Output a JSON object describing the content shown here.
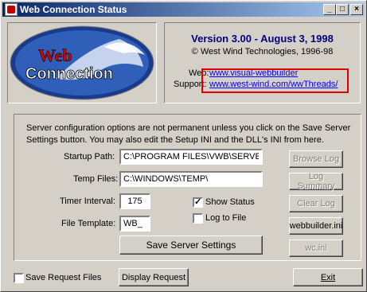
{
  "window": {
    "title": "Web Connection Status"
  },
  "titlebar_buttons": {
    "minimize": "_",
    "maximize": "□",
    "close": "×"
  },
  "logo": {
    "line1": "Web",
    "line2": "Connection"
  },
  "info": {
    "version": "Version 3.00 - August 3, 1998",
    "copyright": "© West Wind Technologies, 1996-98",
    "web_label": "Web:",
    "web_link": "www.visual-webbuilder",
    "support_label": "Support:",
    "support_link": "www.west-wind.com/wwThreads/"
  },
  "settings": {
    "description": "Server configuration options are not permanent unless you click on the Save Server Settings button. You may also edit the Setup INI and the DLL's INI from here.",
    "startup_path_label": "Startup Path:",
    "startup_path_value": "C:\\PROGRAM FILES\\VWB\\SERVER\\",
    "temp_files_label": "Temp Files:",
    "temp_files_value": "C:\\WINDOWS\\TEMP\\",
    "timer_interval_label": "Timer Interval:",
    "timer_interval_value": "175",
    "file_template_label": "File Template:",
    "file_template_value": "WB_",
    "show_status_label": "Show Status",
    "show_status_checked": true,
    "log_to_file_label": "Log to File",
    "log_to_file_checked": false,
    "save_button": "Save Server Settings"
  },
  "side_buttons": {
    "browse_log": "Browse Log",
    "log_summary": "Log Summary",
    "clear_log": "Clear Log",
    "webbuilder_ini": "webbuilder.ini",
    "wc_ini": "wc.ini"
  },
  "bottom": {
    "save_request_files": "Save Request Files",
    "save_request_checked": false,
    "display_request": "Display Request",
    "exit": "Exit"
  },
  "colors": {
    "title_start": "#0a246a",
    "title_end": "#a6caf0",
    "link": "#0000ff",
    "highlight": "#e00000",
    "version": "#000080"
  }
}
